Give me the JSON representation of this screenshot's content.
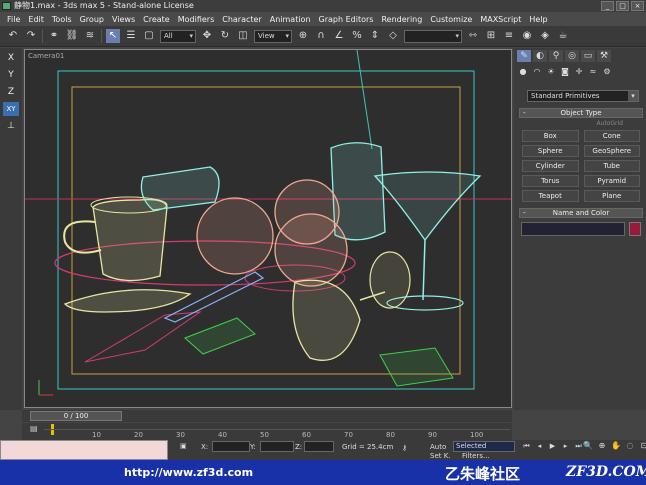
{
  "window": {
    "title": "静物1.max - 3ds max 5 - Stand-alone License",
    "controls": [
      "_",
      "□",
      "×"
    ]
  },
  "menu": [
    "File",
    "Edit",
    "Tools",
    "Group",
    "Views",
    "Create",
    "Modifiers",
    "Character",
    "Animation",
    "Graph Editors",
    "Rendering",
    "Customize",
    "MAXScript",
    "Help"
  ],
  "toolbar": {
    "selection_filter": "All",
    "reference_coord": "View"
  },
  "axes": [
    "X",
    "Y",
    "Z",
    "XY"
  ],
  "viewport": {
    "label": "Camera01"
  },
  "command_panel": {
    "category": "Standard Primitives",
    "object_type_title": "Object Type",
    "autogrid_label": "AutoGrid",
    "buttons": [
      "Box",
      "Cone",
      "Sphere",
      "GeoSphere",
      "Cylinder",
      "Tube",
      "Torus",
      "Pyramid",
      "Teapot",
      "Plane"
    ],
    "name_color_title": "Name and Color",
    "object_color": "#9a1a3c"
  },
  "timeline": {
    "frame_display": "0 / 100",
    "ticks": [
      "10",
      "20",
      "30",
      "40",
      "50",
      "60",
      "70",
      "80",
      "90",
      "100"
    ]
  },
  "status": {
    "x_label": "X:",
    "y_label": "Y:",
    "z_label": "Z:",
    "grid": "Grid = 25.4cm",
    "auto_key": "Auto",
    "selected": "Selected",
    "set_key": "Set K.",
    "filters": "Filters..."
  },
  "banner": {
    "url": "http://www.zf3d.com",
    "cn_name": "乙朱峰社区",
    "brand": "ZF3D.COM"
  },
  "colors": {
    "wire_yellow": "#e8e6a0",
    "wire_cyan": "#8ef0e6",
    "wire_salmon": "#f0a890",
    "wire_red": "#d23c6c",
    "wire_green": "#3cd24a",
    "wire_blue": "#8cb4ff"
  }
}
